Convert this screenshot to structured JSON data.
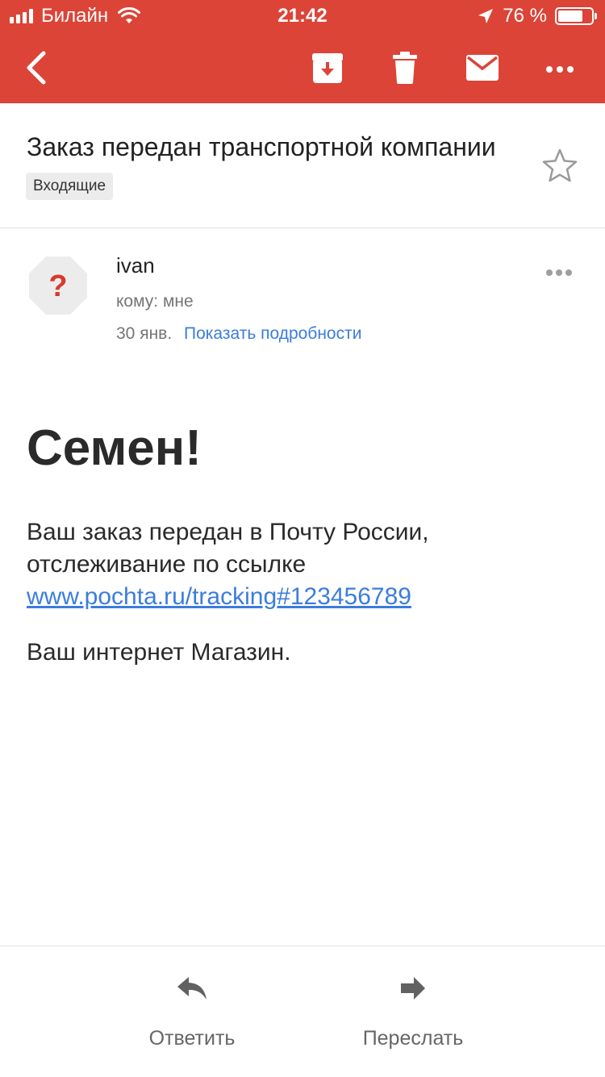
{
  "status_bar": {
    "carrier": "Билайн",
    "time": "21:42",
    "battery_percent": "76 %",
    "battery_level": 0.76
  },
  "toolbar": {
    "back_icon": "chevron-left-icon",
    "archive_icon": "archive-icon",
    "delete_icon": "trash-icon",
    "mark_icon": "envelope-icon",
    "more_icon": "more-horizontal-icon",
    "accent_color": "#dc4437"
  },
  "message": {
    "subject": "Заказ передан транспортной компании",
    "label": "Входящие",
    "sender": "ivan",
    "recipient": "кому: мне",
    "date": "30 янв.",
    "details_link": "Показать подробности"
  },
  "body": {
    "greeting": "Семен!",
    "paragraph_text": "Ваш заказ передан в Почту России, отслеживание по ссылке",
    "tracking_link": "www.pochta.ru/tracking#123456789",
    "signature": "Ваш интернет Магазин."
  },
  "actions": {
    "reply": "Ответить",
    "forward": "Переслать"
  }
}
